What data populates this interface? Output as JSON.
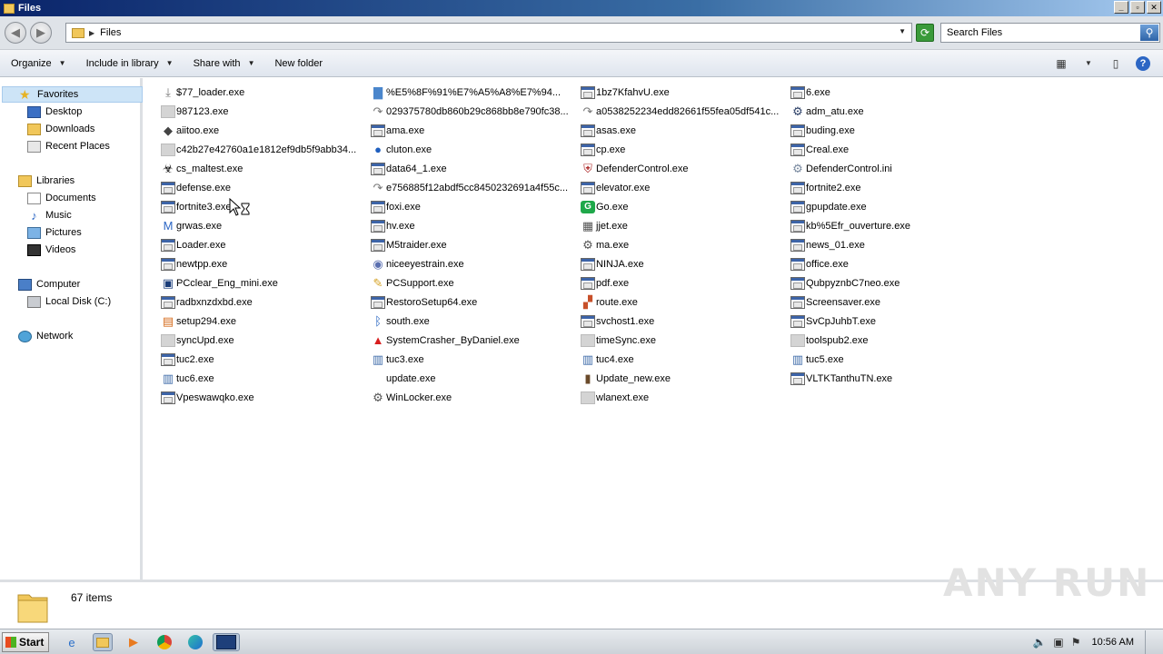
{
  "window": {
    "title": "Files"
  },
  "address": {
    "path": "Files",
    "search_placeholder": "Search Files"
  },
  "toolbar": {
    "organize": "Organize",
    "include_in_library": "Include in library",
    "share_with": "Share with",
    "new_folder": "New folder"
  },
  "nav": {
    "favorites": "Favorites",
    "desktop": "Desktop",
    "downloads": "Downloads",
    "recent_places": "Recent Places",
    "libraries": "Libraries",
    "documents": "Documents",
    "music": "Music",
    "pictures": "Pictures",
    "videos": "Videos",
    "computer": "Computer",
    "local_disk": "Local Disk (C:)",
    "network": "Network"
  },
  "files": {
    "col1": [
      "$77_loader.exe",
      "987123.exe",
      "aiitoo.exe",
      "c42b27e42760a1e1812ef9db5f9abb34...",
      "cs_maltest.exe",
      "defense.exe",
      "fortnite3.exe",
      "grwas.exe",
      "Loader.exe",
      "newtpp.exe",
      "PCclear_Eng_mini.exe",
      "radbxnzdxbd.exe",
      "setup294.exe",
      "syncUpd.exe",
      "tuc2.exe",
      "tuc6.exe",
      "Vpeswawqko.exe"
    ],
    "col2": [
      "%E5%8F%91%E7%A5%A8%E7%94...",
      "029375780db860b29c868bb8e790fc38...",
      "ama.exe",
      "cluton.exe",
      "data64_1.exe",
      "e756885f12abdf5cc8450232691a4f55c...",
      "foxi.exe",
      "hv.exe",
      "M5traider.exe",
      "niceeyestrain.exe",
      "PCSupport.exe",
      "RestoroSetup64.exe",
      "south.exe",
      "SystemCrasher_ByDaniel.exe",
      "tuc3.exe",
      "update.exe",
      "WinLocker.exe"
    ],
    "col3": [
      "1bz7KfahvU.exe",
      "a0538252234edd82661f55fea05df541c...",
      "asas.exe",
      "cp.exe",
      "DefenderControl.exe",
      "elevator.exe",
      "Go.exe",
      "jjet.exe",
      "ma.exe",
      "NINJA.exe",
      "pdf.exe",
      "route.exe",
      "svchost1.exe",
      "timeSync.exe",
      "tuc4.exe",
      "Update_new.exe",
      "wlanext.exe"
    ],
    "col4": [
      "6.exe",
      "adm_atu.exe",
      "buding.exe",
      "Creal.exe",
      "DefenderControl.ini",
      "fortnite2.exe",
      "gpupdate.exe",
      "kb%5Efr_ouverture.exe",
      "news_01.exe",
      "office.exe",
      "QubpyznbC7neo.exe",
      "Screensaver.exe",
      "SvCpJuhbT.exe",
      "toolspub2.exe",
      "tuc5.exe",
      "VLTKTanthuTN.exe"
    ]
  },
  "icons": {
    "col1": [
      "installer-icon",
      "blank-icon",
      "app-icon",
      "blank-icon",
      "biohazard-icon",
      "exe-icon",
      "exe-icon",
      "m-icon",
      "exe-icon",
      "exe-icon",
      "pc-icon",
      "exe-icon",
      "setup-icon",
      "blank-icon",
      "exe-icon",
      "package-icon",
      "exe-icon"
    ],
    "col2": [
      "image-icon",
      "shortcut-icon",
      "exe-icon",
      "globe-icon",
      "exe-icon",
      "shortcut-icon",
      "exe-icon",
      "exe-icon",
      "exe-icon",
      "eye-icon",
      "support-icon",
      "exe-icon",
      "bluetooth-icon",
      "warning-icon",
      "package-icon",
      "none",
      "gear-icon"
    ],
    "col3": [
      "exe-icon",
      "shortcut-icon",
      "exe-icon",
      "exe-icon",
      "defender-icon",
      "exe-icon",
      "go-icon",
      "calculator-icon",
      "gear-icon",
      "exe-icon",
      "exe-icon",
      "route-icon",
      "exe-icon",
      "blank-icon",
      "package-icon",
      "book-icon",
      "blank-icon"
    ],
    "col4": [
      "exe-icon",
      "settings-icon",
      "exe-icon",
      "exe-icon",
      "ini-icon",
      "exe-icon",
      "exe-icon",
      "exe-icon",
      "exe-icon",
      "exe-icon",
      "exe-icon",
      "exe-icon",
      "exe-icon",
      "blank-icon",
      "package-icon",
      "exe-icon"
    ]
  },
  "status": {
    "item_count": "67 items"
  },
  "watermark": "ANY RUN",
  "taskbar": {
    "start": "Start",
    "clock": "10:56 AM"
  }
}
